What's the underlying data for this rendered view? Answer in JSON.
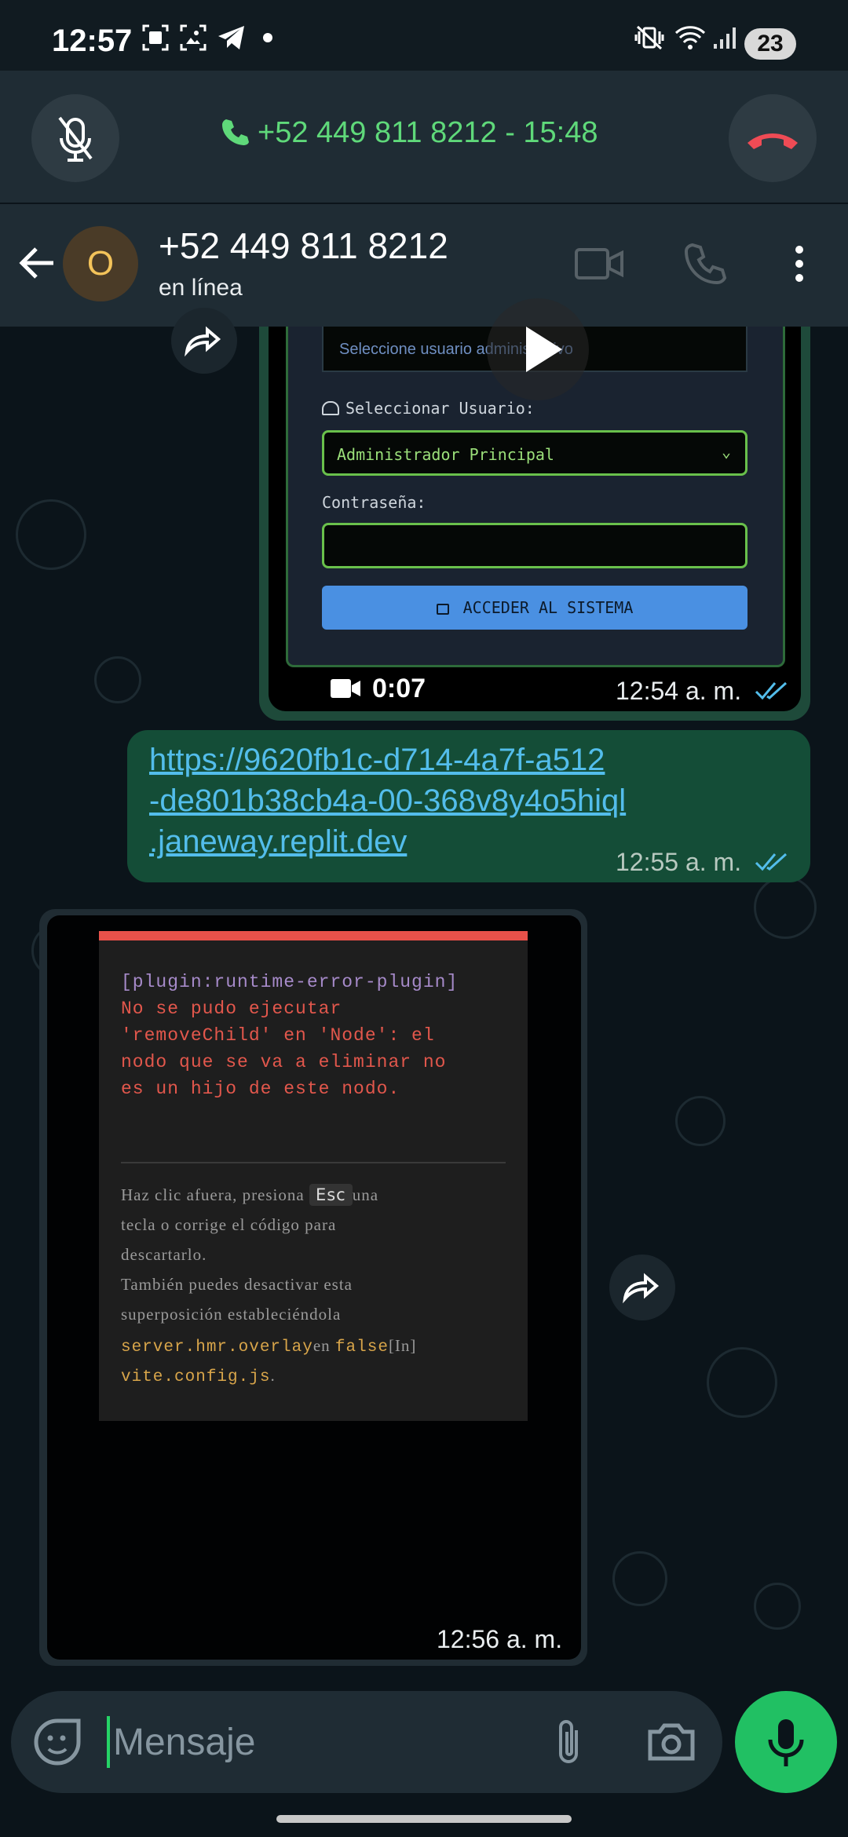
{
  "status_bar": {
    "time": "12:57",
    "battery": "23",
    "icons": [
      "screenshot-icon",
      "image-icon",
      "telegram-icon",
      "dot-icon",
      "vibrate-icon",
      "wifi-icon",
      "signal-icon"
    ]
  },
  "call_bar": {
    "info": "+52 449 811 8212 - 15:48",
    "accent": "#5fd97a",
    "end_color": "#ef4b55"
  },
  "chat_header": {
    "avatar_letter": "O",
    "contact_name": "+52 449 811 8212",
    "contact_status": "en línea"
  },
  "video_message": {
    "terminal_text": "Seleccione usuario administrativo",
    "user_label": "Seleccionar Usuario:",
    "user_select": "Administrador Principal",
    "password_label": "Contraseña:",
    "access_button": "ACCEDER AL SISTEMA",
    "duration": "0:07",
    "time": "12:54 a. m."
  },
  "link_message": {
    "lines": [
      "https://9620fb1c-d714-4a7f-a512",
      "-de801b38cb4a-00-368v8y4o5hiql",
      ".janeway.replit.dev"
    ],
    "time": "12:55 a. m."
  },
  "image_message": {
    "error_title": "[plugin:runtime-error-plugin]",
    "error_lines": [
      "No se pudo ejecutar",
      "'removeChild' en 'Node': el",
      "nodo que se va a eliminar no",
      "es un hijo de este nodo."
    ],
    "hint_a": "Haz clic afuera, presiona ",
    "hint_key": "Esc",
    "hint_b": "una",
    "hint_lines": [
      "tecla o corrige el código para",
      "descartarlo.",
      "También puedes desactivar esta",
      "superposición estableciéndola"
    ],
    "hint_code_1": "server.hmr.overlay",
    "hint_mid": "en ",
    "hint_code_2": "false",
    "hint_in": "[In]",
    "hint_code_3": "vite.config.js",
    "hint_end": ".",
    "time": "12:56 a. m."
  },
  "input_bar": {
    "placeholder": "Mensaje"
  }
}
